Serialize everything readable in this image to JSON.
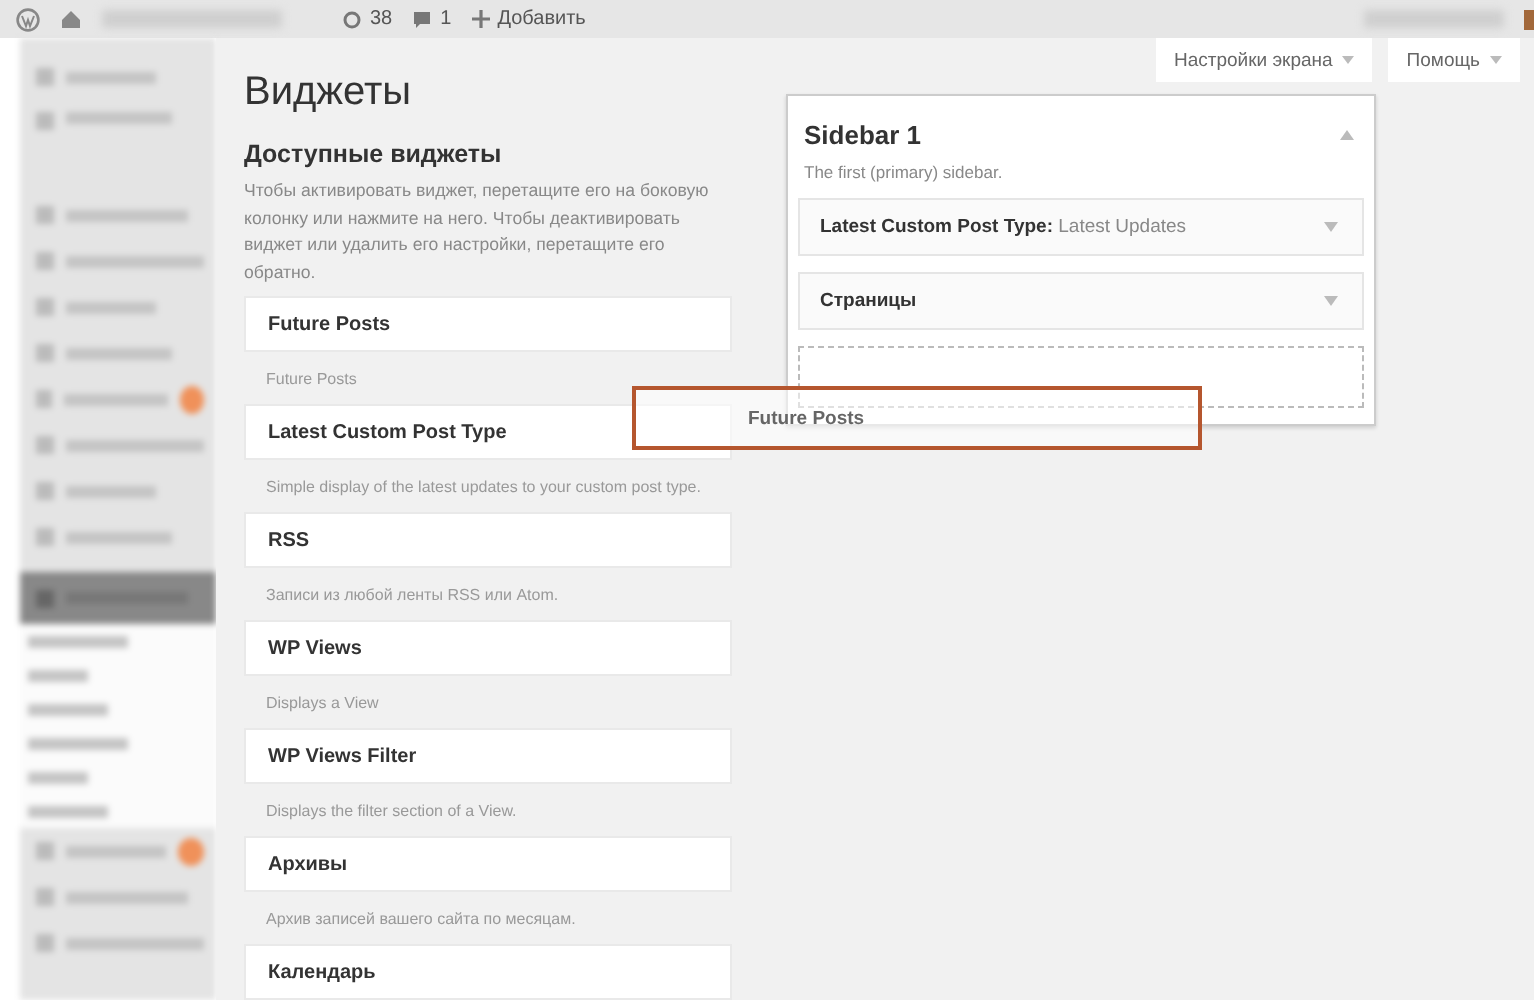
{
  "top_bar": {
    "updates": "38",
    "comments": "1",
    "new_label": "Добавить"
  },
  "admin_menu": [
    {
      "kind": "item",
      "badge": false
    },
    {
      "kind": "tall",
      "badge": false
    },
    {
      "kind": "item",
      "badge": false
    },
    {
      "kind": "item",
      "badge": false
    },
    {
      "kind": "item",
      "badge": false
    },
    {
      "kind": "item",
      "badge": false
    },
    {
      "kind": "item",
      "badge": true
    },
    {
      "kind": "item",
      "badge": false
    },
    {
      "kind": "item",
      "badge": false
    },
    {
      "kind": "item",
      "badge": false
    },
    {
      "kind": "current",
      "badge": false
    },
    {
      "kind": "sub",
      "badge": false
    },
    {
      "kind": "sub",
      "badge": false
    },
    {
      "kind": "sub",
      "badge": false
    },
    {
      "kind": "sub",
      "badge": false
    },
    {
      "kind": "sub",
      "badge": false
    },
    {
      "kind": "sub",
      "badge": false
    },
    {
      "kind": "item",
      "badge": true
    },
    {
      "kind": "item",
      "badge": false
    },
    {
      "kind": "item",
      "badge": false
    }
  ],
  "screen_buttons": [
    "Настройки экрана",
    "Помощь"
  ],
  "title": "Виджеты",
  "available": {
    "heading": "Доступные виджеты",
    "description": "Чтобы активировать виджет, перетащите его на боковую колонку или нажмите на него. Чтобы деактивировать виджет или удалить его настройки, перетащите его обратно.",
    "widgets": [
      {
        "name": "Future Posts",
        "description": "Future Posts"
      },
      {
        "name": "Latest Custom Post Type",
        "description": "Simple display of the latest updates to your custom post type."
      },
      {
        "name": "RSS",
        "description": "Записи из любой ленты RSS или Atom."
      },
      {
        "name": "WP Views",
        "description": "Displays a View"
      },
      {
        "name": "WP Views Filter",
        "description": "Displays the filter section of a View."
      },
      {
        "name": "Архивы",
        "description": "Архив записей вашего сайта по месяцам."
      },
      {
        "name": "Календарь"
      }
    ]
  },
  "sidebar": {
    "title": "Sidebar 1",
    "description": "The first (primary) sidebar.",
    "expanded": true,
    "widgets": [
      {
        "title": "**Latest Custom Post Type:** Latest Updates"
      },
      {
        "title": "**Страницы**"
      }
    ]
  },
  "dragging": {
    "name": "Future Posts"
  }
}
